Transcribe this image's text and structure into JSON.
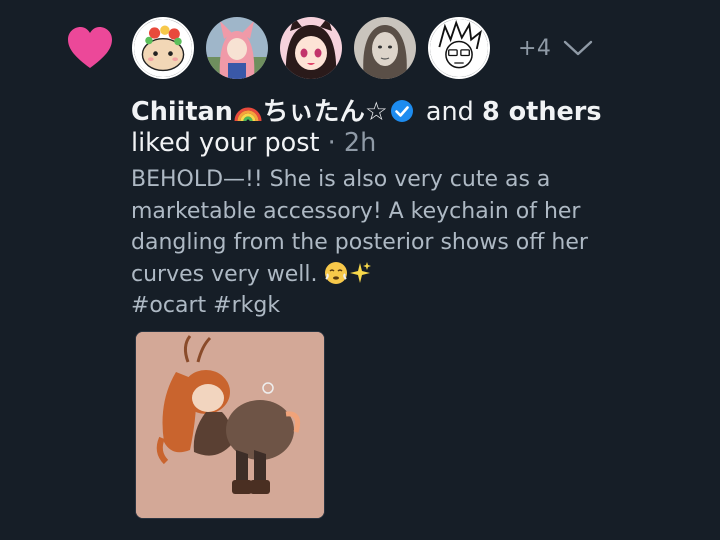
{
  "notification": {
    "icon": "heart-icon",
    "accent_color": "#ec4899",
    "avatars": [
      {
        "name": "avatar-1",
        "bg": "#ffffff"
      },
      {
        "name": "avatar-2",
        "bg": "#9fb6c9"
      },
      {
        "name": "avatar-3",
        "bg": "#f6d2dc"
      },
      {
        "name": "avatar-4",
        "bg": "#c9c4bd"
      },
      {
        "name": "avatar-5",
        "bg": "#ffffff"
      }
    ],
    "more_count": "+4",
    "chevron_icon": "chevron-down-icon",
    "user_name": "Chiitan",
    "user_name_suffix": "ちぃたん☆",
    "verified_color": "#1d8cf0",
    "and_text": "and",
    "others_text": "8 others",
    "action_text": "liked your post",
    "separator": "·",
    "time": "2h"
  },
  "post": {
    "text": "BEHOLD—!! She is also very cute as a marketable accessory! A keychain of her dangling from the posterior shows off her curves very well.",
    "hashtags": "#ocart #rkgk"
  }
}
